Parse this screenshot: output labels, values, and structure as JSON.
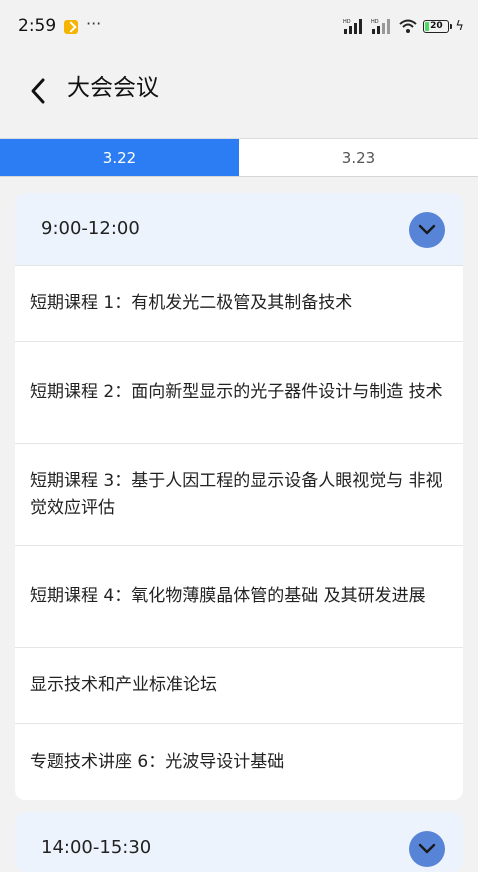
{
  "status_bar": {
    "time": "2:59",
    "more": "···",
    "signal_label": "HD",
    "battery_level": "20",
    "battery_fraction": 0.2,
    "icons": [
      "notification-icon",
      "signal-hd-icon",
      "signal-hd-icon",
      "wifi-icon",
      "battery-icon",
      "charging-icon"
    ]
  },
  "header": {
    "back_icon": "chevron-left-icon",
    "title": "大会会议"
  },
  "tabs": [
    {
      "label": "3.22",
      "active": true
    },
    {
      "label": "3.23",
      "active": false
    }
  ],
  "sessions": [
    {
      "time": "9:00-12:00",
      "expanded": true,
      "toggle_icon": "chevron-down-icon",
      "items": [
        "短期课程 1：有机发光二极管及其制备技术",
        "短期课程 2：面向新型显示的光子器件设计与制造 技术",
        "短期课程 3：基于人因工程的显示设备人眼视觉与 非视觉效应评估",
        "短期课程 4：氧化物薄膜晶体管的基础 及其研发进展",
        "显示技术和产业标准论坛",
        "专题技术讲座 6：光波导设计基础"
      ]
    },
    {
      "time": "14:00-15:30",
      "toggle_icon": "chevron-down-icon"
    }
  ],
  "colors": {
    "accent": "#2c7df3",
    "toggle": "#5784d6",
    "session_head_bg": "#edf3fc",
    "page_bg": "#f2f2f2"
  }
}
